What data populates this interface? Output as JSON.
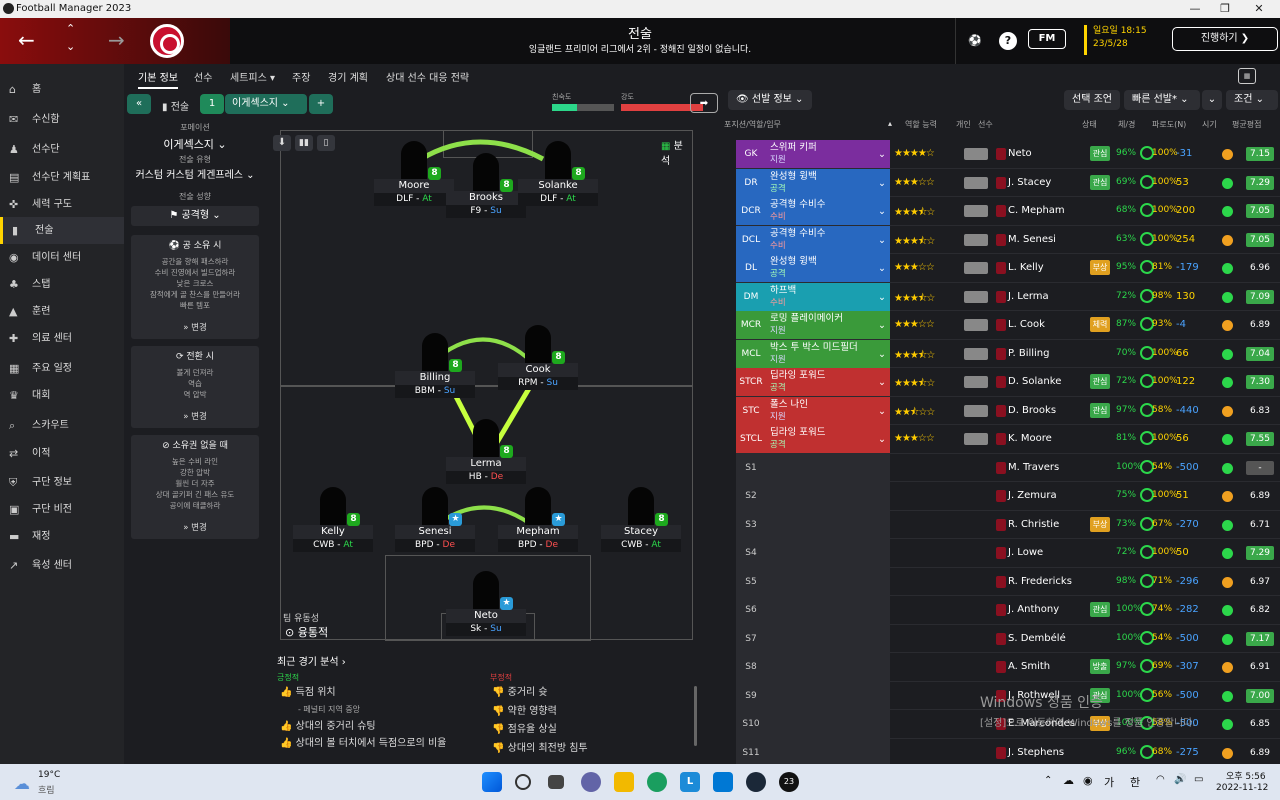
{
  "window": {
    "title": "Football Manager 2023"
  },
  "header": {
    "title": "전술",
    "subtitle": "잉글랜드 프리미어 리그에서 2위 - 정해진 일정이 없습니다.",
    "fm_label": "FM",
    "date_line1": "일요일 18:15",
    "date_line2": "23/5/28",
    "continue_label": "진행하기"
  },
  "sidebar": {
    "items": [
      {
        "label": "홈",
        "icon": "home-icon"
      },
      {
        "label": "수신함",
        "icon": "inbox-icon"
      },
      {
        "label": "선수단",
        "icon": "squad-icon"
      },
      {
        "label": "선수단 계획표",
        "icon": "plan-icon"
      },
      {
        "label": "세력 구도",
        "icon": "dynamics-icon"
      },
      {
        "label": "전술",
        "icon": "tactics-icon"
      },
      {
        "label": "데이터 센터",
        "icon": "data-icon"
      },
      {
        "label": "스탭",
        "icon": "staff-icon"
      },
      {
        "label": "훈련",
        "icon": "training-icon"
      },
      {
        "label": "의료 센터",
        "icon": "medical-icon"
      },
      {
        "label": "주요 일정",
        "icon": "calendar-icon"
      },
      {
        "label": "대회",
        "icon": "trophy-icon"
      },
      {
        "label": "스카우트",
        "icon": "scout-icon"
      },
      {
        "label": "이적",
        "icon": "transfer-icon"
      },
      {
        "label": "구단 정보",
        "icon": "club-icon"
      },
      {
        "label": "구단 비전",
        "icon": "vision-icon"
      },
      {
        "label": "재정",
        "icon": "finance-icon"
      },
      {
        "label": "육성 센터",
        "icon": "development-icon"
      }
    ]
  },
  "topnav": {
    "tabs": [
      "기본 정보",
      "선수",
      "세트피스 ▾",
      "주장",
      "경기 계획",
      "상대 선수 대응 전략"
    ]
  },
  "tacbar": {
    "tactic_label": "전술",
    "slot": "1",
    "tactic_name": "이게섹스지",
    "familiarity_label": "친숙도",
    "intensity_label": "강도",
    "selection_info": "선발 정보",
    "pick_suggest": "선택 조언",
    "quick_pick": "빠른 선발",
    "condition": "조건"
  },
  "leftpanel": {
    "formation_label": "포메이션",
    "formation": "이게섹스지",
    "style_label": "전술 유형",
    "style": "커스텀 커스텀 게겐프레스",
    "mentality_label": "전술 성향",
    "mentality": "공격형",
    "possession_title": "공 소유 시",
    "possession_lines": [
      "공간을 향해 패스하라",
      "수비 진영에서 빌드업하라",
      "낮은 크로스",
      "잠적에게 골 찬스를 만들어라",
      "빠른 템포"
    ],
    "transition_title": "전환 시",
    "transition_lines": [
      "볼게 던져라",
      "역습",
      "역 압박"
    ],
    "defense_title": "소유권 없을 때",
    "defense_lines": [
      "높은 수비 라인",
      "강한 압박",
      "훨씬 더 자주",
      "상대 골키퍼 긴 패스 유도",
      "공이에 태클하라"
    ],
    "change": "변경"
  },
  "pitch": {
    "analysis": "분석",
    "fluidity_label": "팀 유동성",
    "fluidity": "융통적",
    "players": [
      {
        "name": "Moore",
        "role": "DLF",
        "duty": "At"
      },
      {
        "name": "Brooks",
        "role": "F9",
        "duty": "Su"
      },
      {
        "name": "Solanke",
        "role": "DLF",
        "duty": "At"
      },
      {
        "name": "Billing",
        "role": "BBM",
        "duty": "Su"
      },
      {
        "name": "Cook",
        "role": "RPM",
        "duty": "Su"
      },
      {
        "name": "Lerma",
        "role": "HB",
        "duty": "De"
      },
      {
        "name": "Kelly",
        "role": "CWB",
        "duty": "At"
      },
      {
        "name": "Senesi",
        "role": "BPD",
        "duty": "De"
      },
      {
        "name": "Mepham",
        "role": "BPD",
        "duty": "De"
      },
      {
        "name": "Stacey",
        "role": "CWB",
        "duty": "At"
      },
      {
        "name": "Neto",
        "role": "Sk",
        "duty": "Su"
      }
    ],
    "badge": "8"
  },
  "analysis": {
    "title": "최근 경기 분석",
    "positive_label": "긍정적",
    "negative_label": "부정적",
    "positive": [
      "득점 위치",
      "- 페널티 지역 중앙",
      "상대의 중거리 슈팅",
      "상대의 볼 터치에서 득점으로의 비율",
      "패스 차단 후 슈팅"
    ],
    "negative": [
      "중거리 슛",
      "약한 영향력",
      "점유율 상실",
      "상대의 최전방 침투"
    ]
  },
  "table": {
    "headers": [
      "포지션/역할/임무",
      "역할 능력",
      "개인",
      "선수",
      "상태",
      "체/경",
      "파로도(N)",
      "시기",
      "평균평점"
    ],
    "rows": [
      {
        "pos": "GK",
        "role": "스위퍼 키퍼",
        "duty": "지원",
        "stars": 4,
        "name": "Neto",
        "tag": "관심",
        "cond": "96%",
        "sharp": "100%",
        "val": "-31",
        "rating": "7.15",
        "color": "#7b2d9e"
      },
      {
        "pos": "DR",
        "role": "완성형 윙백",
        "duty": "공격",
        "stars": 3,
        "name": "J. Stacey",
        "tag": "관심",
        "cond": "69%",
        "sharp": "100%",
        "val": "53",
        "rating": "7.29",
        "color": "#2868c0"
      },
      {
        "pos": "DCR",
        "role": "공격형 수비수",
        "duty": "수비",
        "stars": 3.5,
        "name": "C. Mepham",
        "tag": "",
        "cond": "68%",
        "sharp": "100%",
        "val": "200",
        "rating": "7.05",
        "color": "#2868c0"
      },
      {
        "pos": "DCL",
        "role": "공격형 수비수",
        "duty": "수비",
        "stars": 3.5,
        "name": "M. Senesi",
        "tag": "",
        "cond": "63%",
        "sharp": "100%",
        "val": "254",
        "rating": "7.05",
        "color": "#2868c0"
      },
      {
        "pos": "DL",
        "role": "완성형 윙백",
        "duty": "공격",
        "stars": 3,
        "name": "L. Kelly",
        "tag": "부상",
        "cond": "95%",
        "sharp": "81%",
        "val": "-179",
        "rating": "6.96",
        "color": "#2868c0"
      },
      {
        "pos": "DM",
        "role": "하프백",
        "duty": "수비",
        "stars": 3.5,
        "name": "J. Lerma",
        "tag": "",
        "cond": "72%",
        "sharp": "98%",
        "val": "130",
        "rating": "7.09",
        "color": "#1a9fb0"
      },
      {
        "pos": "MCR",
        "role": "로밍 플레이메이커",
        "duty": "지원",
        "stars": 3,
        "name": "L. Cook",
        "tag": "체력",
        "cond": "87%",
        "sharp": "93%",
        "val": "-4",
        "rating": "6.89",
        "color": "#3a9a3a"
      },
      {
        "pos": "MCL",
        "role": "박스 투 박스 미드필더",
        "duty": "지원",
        "stars": 3.5,
        "name": "P. Billing",
        "tag": "",
        "cond": "70%",
        "sharp": "100%",
        "val": "66",
        "rating": "7.04",
        "color": "#3a9a3a"
      },
      {
        "pos": "STCR",
        "role": "딥라잉 포워드",
        "duty": "공격",
        "stars": 3.5,
        "name": "D. Solanke",
        "tag": "관심",
        "cond": "72%",
        "sharp": "100%",
        "val": "122",
        "rating": "7.30",
        "color": "#c03030"
      },
      {
        "pos": "STC",
        "role": "폴스 나인",
        "duty": "지원",
        "stars": 2.5,
        "name": "D. Brooks",
        "tag": "관심",
        "cond": "97%",
        "sharp": "58%",
        "val": "-440",
        "rating": "6.83",
        "color": "#c03030"
      },
      {
        "pos": "STCL",
        "role": "딥라잉 포워드",
        "duty": "공격",
        "stars": 3,
        "name": "K. Moore",
        "tag": "",
        "cond": "81%",
        "sharp": "100%",
        "val": "56",
        "rating": "7.55",
        "color": "#c03030"
      },
      {
        "pos": "S1",
        "role": "",
        "duty": "",
        "stars": 0,
        "name": "M. Travers",
        "tag": "",
        "cond": "100%",
        "sharp": "54%",
        "val": "-500",
        "rating": "-",
        "color": ""
      },
      {
        "pos": "S2",
        "role": "",
        "duty": "",
        "stars": 0,
        "name": "J. Zemura",
        "tag": "",
        "cond": "75%",
        "sharp": "100%",
        "val": "51",
        "rating": "6.89",
        "color": ""
      },
      {
        "pos": "S3",
        "role": "",
        "duty": "",
        "stars": 0,
        "name": "R. Christie",
        "tag": "부상",
        "cond": "73%",
        "sharp": "67%",
        "val": "-270",
        "rating": "6.71",
        "color": ""
      },
      {
        "pos": "S4",
        "role": "",
        "duty": "",
        "stars": 0,
        "name": "J. Lowe",
        "tag": "",
        "cond": "72%",
        "sharp": "100%",
        "val": "50",
        "rating": "7.29",
        "color": ""
      },
      {
        "pos": "S5",
        "role": "",
        "duty": "",
        "stars": 0,
        "name": "R. Fredericks",
        "tag": "",
        "cond": "98%",
        "sharp": "71%",
        "val": "-296",
        "rating": "6.97",
        "color": ""
      },
      {
        "pos": "S6",
        "role": "",
        "duty": "",
        "stars": 0,
        "name": "J. Anthony",
        "tag": "관심",
        "cond": "100%",
        "sharp": "74%",
        "val": "-282",
        "rating": "6.82",
        "color": ""
      },
      {
        "pos": "S7",
        "role": "",
        "duty": "",
        "stars": 0,
        "name": "S. Dembélé",
        "tag": "",
        "cond": "100%",
        "sharp": "54%",
        "val": "-500",
        "rating": "7.17",
        "color": ""
      },
      {
        "pos": "S8",
        "role": "",
        "duty": "",
        "stars": 0,
        "name": "A. Smith",
        "tag": "방출",
        "cond": "97%",
        "sharp": "69%",
        "val": "-307",
        "rating": "6.91",
        "color": ""
      },
      {
        "pos": "S9",
        "role": "",
        "duty": "",
        "stars": 0,
        "name": "J. Rothwell",
        "tag": "관심",
        "cond": "100%",
        "sharp": "56%",
        "val": "-500",
        "rating": "7.00",
        "color": ""
      },
      {
        "pos": "S10",
        "role": "",
        "duty": "",
        "stars": 0,
        "name": "E. Marcondes",
        "tag": "부상",
        "cond": "100%",
        "sharp": "58%",
        "val": "-500",
        "rating": "6.85",
        "color": ""
      },
      {
        "pos": "S11",
        "role": "",
        "duty": "",
        "stars": 0,
        "name": "J. Stephens",
        "tag": "",
        "cond": "96%",
        "sharp": "68%",
        "val": "-275",
        "rating": "6.89",
        "color": ""
      }
    ]
  },
  "watermark": {
    "line1": "Windows 정품 인증",
    "line2": "[설정]으로 이동하여 Windows를 정품 인증합니다."
  },
  "taskbar": {
    "weather_temp": "19°C",
    "weather_desc": "흐림",
    "ime": "가",
    "lang": "한",
    "time": "오후 5:56",
    "date": "2022-11-12"
  }
}
